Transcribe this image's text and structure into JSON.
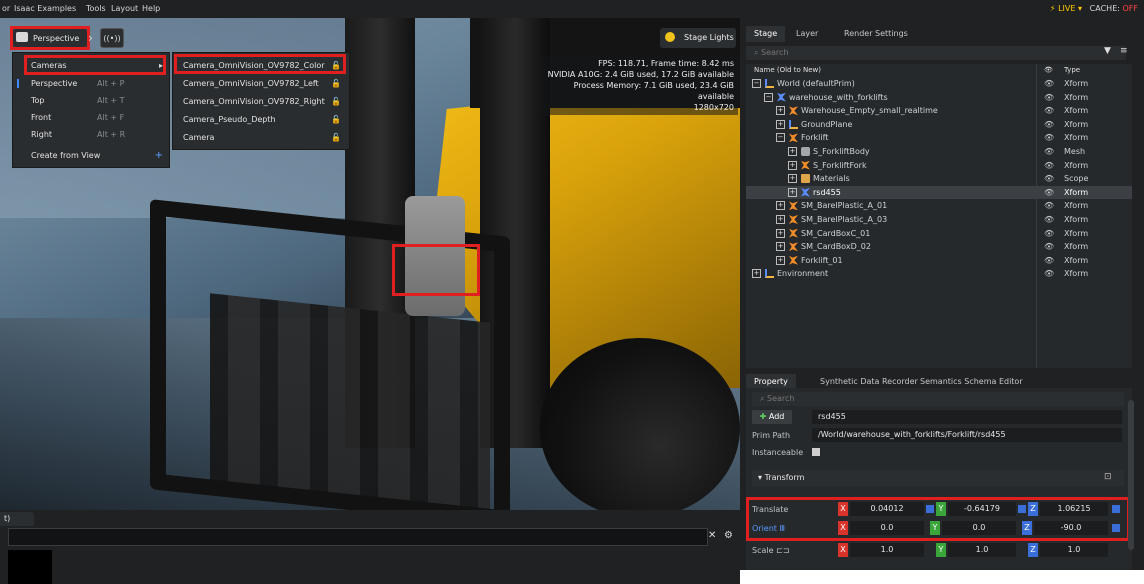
{
  "menubar": {
    "items": [
      "or",
      "Isaac Examples",
      "Tools",
      "Layout",
      "Help"
    ],
    "live": "LIVE",
    "cache": "CACHE:",
    "cache_state": "OFF"
  },
  "viewport": {
    "perspective_label": "Perspective",
    "stage_lights": "Stage Lights",
    "stats": [
      "FPS: 118.71, Frame time: 8.42 ms",
      "NVIDIA A10G: 2.4 GiB used, 17.2 GiB available",
      "Process Memory: 7.1 GiB used, 23.4 GiB available",
      "1280x720"
    ]
  },
  "camera_menu": {
    "items": [
      {
        "label": "Cameras",
        "shortcut": "",
        "has_submenu": true
      },
      {
        "label": "Perspective",
        "shortcut": "Alt + P"
      },
      {
        "label": "Top",
        "shortcut": "Alt + T"
      },
      {
        "label": "Front",
        "shortcut": "Alt + F"
      },
      {
        "label": "Right",
        "shortcut": "Alt + R"
      },
      {
        "label": "Create from View",
        "shortcut": ""
      }
    ],
    "submenu": [
      "Camera_OmniVision_OV9782_Color",
      "Camera_OmniVision_OV9782_Left",
      "Camera_OmniVision_OV9782_Right",
      "Camera_Pseudo_Depth",
      "Camera"
    ]
  },
  "stage": {
    "tabs": [
      "Stage",
      "Layer",
      "Render Settings"
    ],
    "search_placeholder": "Search",
    "col_name": "Name (Old to New)",
    "col_type": "Type",
    "rows": [
      {
        "name": "World (defaultPrim)",
        "type": "Xform",
        "indent": 0,
        "icon": "axis"
      },
      {
        "name": "warehouse_with_forklifts",
        "type": "Xform",
        "indent": 1,
        "icon": "blue"
      },
      {
        "name": "Warehouse_Empty_small_realtime",
        "type": "Xform",
        "indent": 2,
        "icon": "xform"
      },
      {
        "name": "GroundPlane",
        "type": "Xform",
        "indent": 2,
        "icon": "axis"
      },
      {
        "name": "Forklift",
        "type": "Xform",
        "indent": 2,
        "icon": "xform"
      },
      {
        "name": "S_ForkliftBody",
        "type": "Mesh",
        "indent": 3,
        "icon": "mesh"
      },
      {
        "name": "S_ForkliftFork",
        "type": "Xform",
        "indent": 3,
        "icon": "xform"
      },
      {
        "name": "Materials",
        "type": "Scope",
        "indent": 3,
        "icon": "folder"
      },
      {
        "name": "rsd455",
        "type": "Xform",
        "indent": 3,
        "icon": "blue",
        "selected": true
      },
      {
        "name": "SM_BarelPlastic_A_01",
        "type": "Xform",
        "indent": 2,
        "icon": "xform"
      },
      {
        "name": "SM_BarelPlastic_A_03",
        "type": "Xform",
        "indent": 2,
        "icon": "xform"
      },
      {
        "name": "SM_CardBoxC_01",
        "type": "Xform",
        "indent": 2,
        "icon": "xform"
      },
      {
        "name": "SM_CardBoxD_02",
        "type": "Xform",
        "indent": 2,
        "icon": "xform"
      },
      {
        "name": "Forklift_01",
        "type": "Xform",
        "indent": 2,
        "icon": "xform"
      },
      {
        "name": "Environment",
        "type": "Xform",
        "indent": 0,
        "icon": "axis"
      }
    ]
  },
  "property": {
    "tabs": [
      "Property",
      "Synthetic Data Recorder",
      "Semantics Schema Editor"
    ],
    "search_placeholder": "Search",
    "add_label": "Add",
    "prim_name": "rsd455",
    "prim_path_label": "Prim Path",
    "prim_path": "/World/warehouse_with_forklifts/Forklift/rsd455",
    "instanceable_label": "Instanceable",
    "transform_label": "Transform",
    "translate_label": "Translate",
    "translate": {
      "x": "0.04012",
      "y": "-0.64179",
      "z": "1.06215"
    },
    "orient_label": "Orient",
    "orient": {
      "x": "0.0",
      "y": "0.0",
      "z": "-90.0"
    },
    "scale_label": "Scale",
    "scale": {
      "x": "1.0",
      "y": "1.0",
      "z": "1.0"
    }
  },
  "bottom": {
    "tab_label": "t)"
  }
}
